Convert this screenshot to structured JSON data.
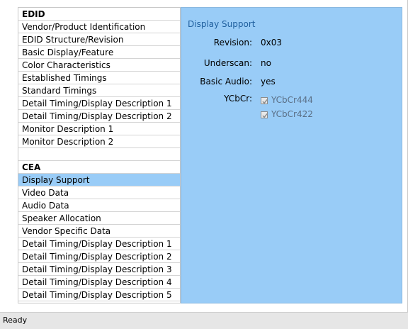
{
  "tree": {
    "edid_header": "EDID",
    "edid_items": [
      "Vendor/Product Identification",
      "EDID Structure/Revision",
      "Basic Display/Feature",
      "Color Characteristics",
      "Established Timings",
      "Standard Timings",
      "Detail Timing/Display Description 1",
      "Detail Timing/Display Description 2",
      "Monitor Description 1",
      "Monitor Description 2"
    ],
    "cea_header": "CEA",
    "cea_items": [
      "Display Support",
      "Video Data",
      "Audio Data",
      "Speaker Allocation",
      "Vendor Specific Data",
      "Detail Timing/Display Description 1",
      "Detail Timing/Display Description 2",
      "Detail Timing/Display Description 3",
      "Detail Timing/Display Description 4",
      "Detail Timing/Display Description 5"
    ],
    "selected": "Display Support"
  },
  "panel": {
    "title": "Display Support",
    "revision_label": "Revision:",
    "revision_value": "0x03",
    "underscan_label": "Underscan:",
    "underscan_value": "no",
    "basic_audio_label": "Basic Audio:",
    "basic_audio_value": "yes",
    "ycbcr_label": "YCbCr:",
    "ycbcr444_label": "YCbCr444",
    "ycbcr444_checked": true,
    "ycbcr422_label": "YCbCr422",
    "ycbcr422_checked": true
  },
  "status": {
    "text": "Ready"
  },
  "colors": {
    "selection": "#99ccf7",
    "panel_bg": "#99ccf7",
    "title": "#1f5f9e"
  }
}
